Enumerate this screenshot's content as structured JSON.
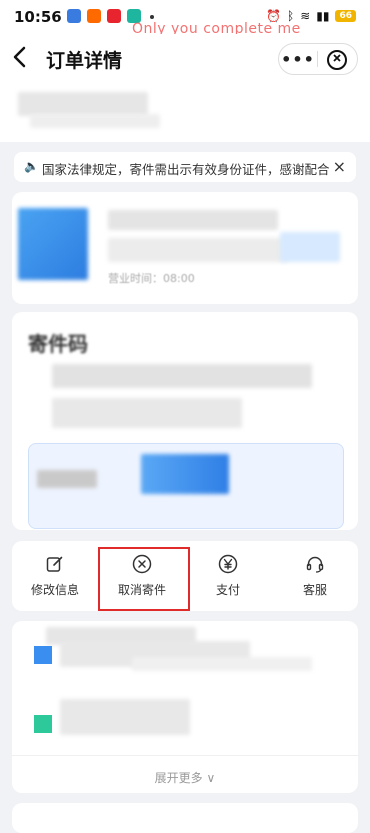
{
  "status_bar": {
    "time": "10:56",
    "battery": "66"
  },
  "watermark": "Only you complete me",
  "nav": {
    "back_icon": "chevron-left-icon",
    "title": "订单详情",
    "more_label": "•••"
  },
  "notice": {
    "text": "国家法律规定，寄件需出示有效身份证件，感谢配合",
    "close": "×"
  },
  "store": {
    "hours_label": "营业时间：08:00"
  },
  "package": {
    "title_partial": "寄件码"
  },
  "actions": [
    {
      "label": "修改信息",
      "icon": "edit-icon"
    },
    {
      "label": "取消寄件",
      "icon": "cancel-circle-icon"
    },
    {
      "label": "支付",
      "icon": "yen-circle-icon"
    },
    {
      "label": "客服",
      "icon": "headset-icon"
    }
  ],
  "list": {
    "expand_label": "展开更多"
  },
  "colors": {
    "highlight": "#e02b2b",
    "accent_blue": "#3a8ef0",
    "accent_green": "#2ec99a"
  }
}
